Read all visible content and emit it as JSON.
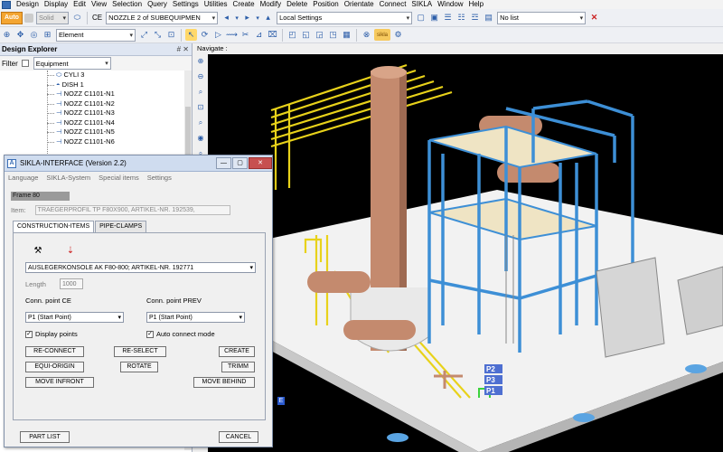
{
  "menubar": {
    "items": [
      "Design",
      "Display",
      "Edit",
      "View",
      "Selection",
      "Query",
      "Settings",
      "Utilities",
      "Create",
      "Modify",
      "Delete",
      "Position",
      "Orientate",
      "Connect",
      "SIKLA",
      "Window",
      "Help"
    ]
  },
  "toolbar1": {
    "auto_label": "Auto",
    "solid_label": "Solid",
    "ce_label": "CE",
    "ce_value": "NOZZLE 2 of SUBEQUIPMEN",
    "settings_value": "Local Settings",
    "list_value": "No list"
  },
  "toolbar2": {
    "element_value": "Element"
  },
  "explorer": {
    "title": "Design Explorer",
    "pins": "# ✕",
    "filter_label": "Filter",
    "filter_value": "Equipment",
    "tree": [
      "CYLI 3",
      "DISH 1",
      "NOZZ C1101-N1",
      "NOZZ C1101-N2",
      "NOZZ C1101-N3",
      "NOZZ C1101-N4",
      "NOZZ C1101-N5",
      "NOZZ C1101-N6"
    ]
  },
  "viewport": {
    "title": "Navigate :",
    "tags": [
      "P2",
      "P3",
      "P1"
    ],
    "corner_tag": "E"
  },
  "dialog": {
    "title": "SIKLA-INTERFACE (Version 2.2)",
    "menu": [
      "Language",
      "SIKLA-System",
      "Special items",
      "Settings"
    ],
    "frame_label": "Frame 80",
    "item_label": "Item:",
    "item_value": "TRAEGERPROFIL TP F80X900, ARTIKEL-NR. 192539,",
    "tabs": [
      "CONSTRUCTION-ITEMS",
      "PIPE-CLAMPS"
    ],
    "construction_value": "AUSLEGERKONSOLE AK F80-800; ARTIKEL-NR. 192771",
    "length_label": "Length",
    "length_value": "1000",
    "conn_ce_label": "Conn. point CE",
    "conn_prev_label": "Conn. point PREV",
    "conn_ce_value": "P1  (Start Point)",
    "conn_prev_value": "P1  (Start Point)",
    "display_points_label": "Display points",
    "auto_connect_label": "Auto connect mode",
    "buttons": {
      "reconnect": "RE-CONNECT",
      "reselect": "RE-SELECT",
      "create": "CREATE",
      "equi_origin": "EQUI-ORIGIN",
      "rotate": "ROTATE",
      "trimm": "TRIMM",
      "move_infront": "MOVE INFRONT",
      "move_behind": "MOVE BEHIND",
      "part_list": "PART LIST",
      "cancel": "CANCEL"
    }
  },
  "colors": {
    "steel": "#3d8fd6",
    "pipes": "#e8d21a",
    "column": "#c48a6e",
    "deck": "#efe4c4",
    "platform": "#f2f2f2"
  }
}
